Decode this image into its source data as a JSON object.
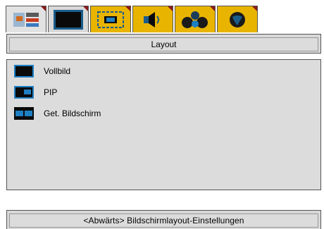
{
  "tabs": [
    {
      "icon": "picture-settings-icon"
    },
    {
      "icon": "screen-icon"
    },
    {
      "icon": "layout-icon"
    },
    {
      "icon": "speaker-icon"
    },
    {
      "icon": "people-icon"
    },
    {
      "icon": "globe-icon"
    }
  ],
  "title": "Layout",
  "menu": {
    "items": [
      {
        "label": "Vollbild",
        "icon": "fullscreen-layout-icon"
      },
      {
        "label": "PIP",
        "icon": "pip-layout-icon"
      },
      {
        "label": "Get. Bildschirm",
        "icon": "split-screen-layout-icon"
      }
    ]
  },
  "hint": "<Abwärts> Bildschirmlayout-Einstellungen",
  "colors": {
    "panel": "#dcdcdc",
    "accent_gold": "#e8b400",
    "tab_marker": "#8b1a1a",
    "icon_blue": "#1e7fc4"
  }
}
